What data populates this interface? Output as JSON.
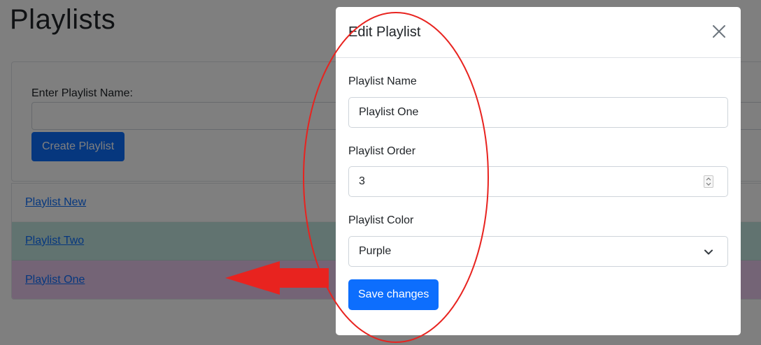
{
  "page": {
    "title": "Playlists",
    "create_label": "Enter Playlist Name:",
    "create_input_value": "",
    "create_button": "Create Playlist",
    "playlists": [
      {
        "name": "Playlist New",
        "color": "#ffffff"
      },
      {
        "name": "Playlist Two",
        "color": "#c3e6e0"
      },
      {
        "name": "Playlist One",
        "color": "#e8c8ec"
      }
    ]
  },
  "modal": {
    "title": "Edit Playlist",
    "name_label": "Playlist Name",
    "name_value": "Playlist One",
    "order_label": "Playlist Order",
    "order_value": "3",
    "color_label": "Playlist Color",
    "color_value": "Purple",
    "save_button": "Save changes",
    "close_icon": "close-x-icon"
  },
  "colors": {
    "primary": "#0d6efd",
    "annotation": "#e8231f",
    "backdrop": "rgba(0,0,0,0.5)"
  }
}
